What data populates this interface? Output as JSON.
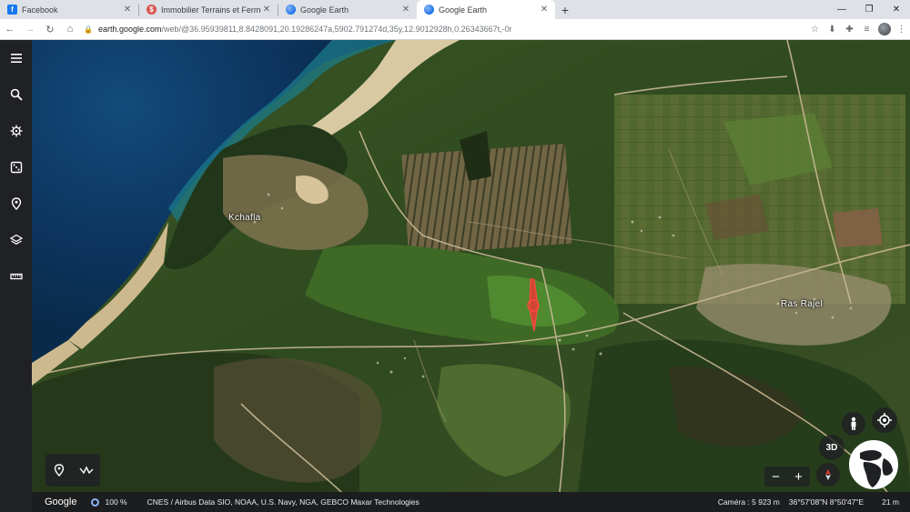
{
  "browser": {
    "tabs": [
      {
        "title": "Facebook",
        "favicon": "facebook-icon",
        "active": false
      },
      {
        "title": "Immobilier Terrains et Fermes - T",
        "favicon": "immobilier-icon",
        "active": false
      },
      {
        "title": "Google Earth",
        "favicon": "google-earth-icon",
        "active": false
      },
      {
        "title": "Google Earth",
        "favicon": "google-earth-icon",
        "active": true
      }
    ],
    "url_host": "earth.google.com",
    "url_path": "/web/@36.95939811,8.8428091,20.19286247a,5902.791274d,35y,12.9012928h,0.26343667t,-0r"
  },
  "map": {
    "labels": [
      {
        "text": "Kchafla"
      },
      {
        "text": "Ras Rajel"
      }
    ]
  },
  "controls": {
    "view_mode": "3D",
    "zoom_out": "−",
    "zoom_in": "+"
  },
  "status": {
    "logo": "Google",
    "zoom": "100 %",
    "credits": "CNES / Airbus   Data SIO, NOAA, U.S. Navy, NGA, GEBCO   Maxar Technologies",
    "camera": "Caméra : 5 923 m",
    "coords": "36°57'08\"N 8°50'47\"E",
    "scale": "21 m"
  },
  "colors": {
    "sea": "#0d3d6b",
    "coast": "#d9c9a3",
    "forest": "#2f4a1f",
    "field": "#5a7a36",
    "marker": "#e53935",
    "rail": "#202124"
  }
}
